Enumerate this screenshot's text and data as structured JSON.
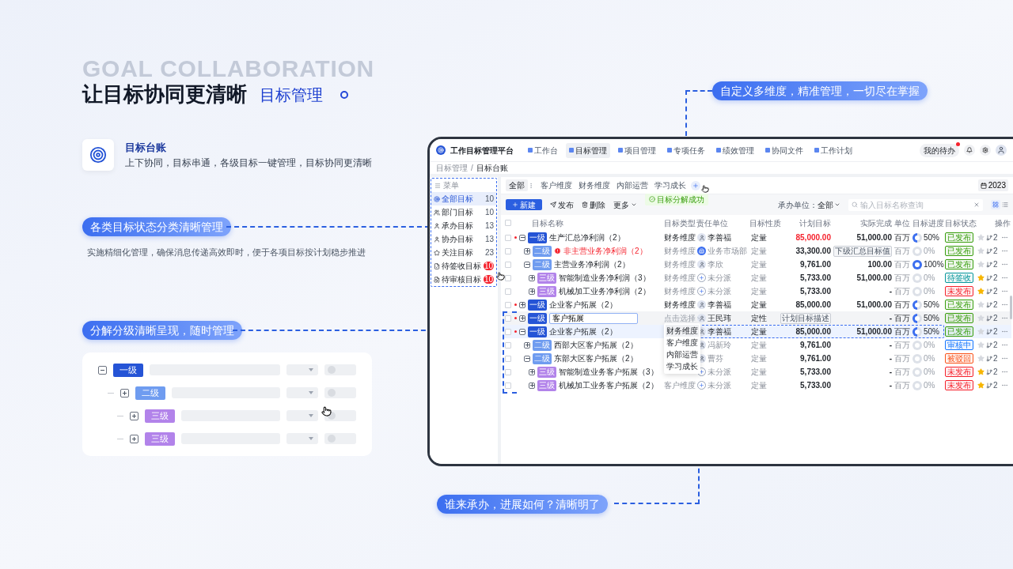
{
  "hero": {
    "ghost_title": "GOAL COLLABORATION",
    "title": "让目标协同更清晰",
    "subtitle": "目标管理"
  },
  "feature": {
    "title": "目标台账",
    "description": "上下协同，目标串通，各级目标一键管理，目标协同更清晰"
  },
  "callout_status": {
    "text": "各类目标状态分类清晰管理",
    "description": "实施精细化管理，确保消息传递高效即时，便于各项目标按计划稳步推进"
  },
  "callout_tree": {
    "text": "分解分级清晰呈现，随时管理"
  },
  "tree_demo": {
    "nodes": [
      {
        "tag": "一级",
        "expanded": true,
        "children": [
          {
            "tag": "二级",
            "expanded": false,
            "children": [
              {
                "tag": "三级",
                "expanded": false
              },
              {
                "tag": "三级",
                "expanded": false
              }
            ]
          }
        ]
      }
    ]
  },
  "callout_dimensions": {
    "text": "自定义多维度，精准管理，一切尽在掌握"
  },
  "callout_owner": {
    "text": "谁来承办，进展如何？清晰明了"
  },
  "app": {
    "brand": "工作目标管理平台",
    "nav": [
      {
        "label": "工作台",
        "selected": false
      },
      {
        "label": "目标管理",
        "selected": true
      },
      {
        "label": "项目管理",
        "selected": false
      },
      {
        "label": "专项任务",
        "selected": false
      },
      {
        "label": "绩效管理",
        "selected": false
      },
      {
        "label": "协同文件",
        "selected": false
      },
      {
        "label": "工作计划",
        "selected": false
      }
    ],
    "todo": {
      "label": "我的待办",
      "unread": true
    },
    "breadcrumb": {
      "items": [
        "目标管理",
        "目标台账"
      ],
      "separator": "/"
    },
    "sidebar": {
      "header": "菜单",
      "items": [
        {
          "label": "全部目标",
          "count": "10",
          "alert": false,
          "selected": true
        },
        {
          "label": "部门目标",
          "count": "10",
          "alert": false,
          "selected": false
        },
        {
          "label": "承办目标",
          "count": "13",
          "alert": false,
          "selected": false
        },
        {
          "label": "协办目标",
          "count": "13",
          "alert": false,
          "selected": false
        },
        {
          "label": "关注目标",
          "count": "23",
          "alert": false,
          "selected": false
        },
        {
          "label": "待签收目标",
          "count": "10",
          "alert": true,
          "selected": false
        },
        {
          "label": "待审核目标",
          "count": "10",
          "alert": true,
          "selected": false
        }
      ]
    },
    "tabs": [
      {
        "label": "全部",
        "selected": true
      },
      {
        "label": "客户维度",
        "selected": false
      },
      {
        "label": "财务维度",
        "selected": false
      },
      {
        "label": "内部运营",
        "selected": false
      },
      {
        "label": "学习成长",
        "selected": false
      }
    ],
    "year": "2023",
    "toast": "目标分解成功",
    "toolbar": {
      "new": "新建",
      "publish": "发布",
      "delete": "删除",
      "more": "更多"
    },
    "filter": {
      "label": "承办单位：",
      "value": "全部"
    },
    "search": {
      "placeholder": "输入目标名称查询"
    },
    "table": {
      "columns": [
        "目标名称",
        "目标类型",
        "责任单位",
        "目标性质",
        "计划目标",
        "实际完成",
        "单位",
        "目标进度",
        "目标状态",
        "操作"
      ],
      "select_all": {
        "checked": false
      },
      "rows": [
        {
          "kind": "goal",
          "checked": false,
          "tag": "一级",
          "name": "生产汇总净利润（2）",
          "expanded": true,
          "flagged": true,
          "alert": false,
          "highlighted": false,
          "type": "财务维度",
          "owner": {
            "name": "李善福",
            "kind": "person"
          },
          "nature": "定量",
          "plan": {
            "kind": "warning",
            "text": "85,000.00"
          },
          "actual": "51,000.00",
          "unit": "百万",
          "progress": {
            "level": 0.5,
            "text": "50%"
          },
          "status": {
            "text": "已发布",
            "color": "#389e0d"
          },
          "starred": false,
          "share": "2",
          "children": [
            {
              "kind": "goal",
              "checked": false,
              "tag": "二级",
              "name": "非主营业务净利润（2）",
              "expanded": false,
              "flagged": false,
              "alert": true,
              "highlighted": false,
              "type": "财务维度",
              "owner": {
                "name": "业务市场部",
                "kind": "org"
              },
              "nature": "定量",
              "plan": "33,300.00",
              "actual": {
                "kind": "tag",
                "text": "下级汇总目标值"
              },
              "unit": "百万",
              "progress": {
                "level": 0,
                "text": "0%"
              },
              "status": {
                "text": "已发布",
                "color": "#389e0d"
              },
              "starred": false,
              "share": "2"
            },
            {
              "kind": "goal",
              "checked": false,
              "tag": "二级",
              "name": "主营业务净利润（2）",
              "expanded": true,
              "flagged": false,
              "alert": false,
              "highlighted": false,
              "type": "财务维度",
              "owner": {
                "name": "李欣",
                "kind": "person"
              },
              "nature": "定量",
              "plan": "9,761.00",
              "actual": "100.00",
              "unit": "百万",
              "progress": {
                "level": 1,
                "text": "100%"
              },
              "status": {
                "text": "已发布",
                "color": "#389e0d"
              },
              "starred": false,
              "share": "2",
              "children": [
                {
                  "kind": "goal",
                  "checked": false,
                  "tag": "三级",
                  "name": "智能制造业务净利润（3）",
                  "expanded": false,
                  "flagged": false,
                  "alert": false,
                  "highlighted": false,
                  "type": "财务维度",
                  "owner": {
                    "name": "未分派",
                    "kind": "unassigned"
                  },
                  "nature": "定量",
                  "plan": "5,733.00",
                  "actual": "51,000.00",
                  "unit": "百万",
                  "progress": {
                    "level": 0,
                    "text": "0%"
                  },
                  "status": {
                    "text": "待签收",
                    "color": "#08979c"
                  },
                  "starred": true,
                  "share": "2"
                },
                {
                  "kind": "goal",
                  "checked": false,
                  "tag": "三级",
                  "name": "机械加工业务净利润（2）",
                  "expanded": false,
                  "flagged": false,
                  "alert": false,
                  "highlighted": false,
                  "type": "财务维度",
                  "owner": {
                    "name": "未分派",
                    "kind": "unassigned"
                  },
                  "nature": "定量",
                  "plan": "5,733.00",
                  "actual": "-",
                  "unit": "百万",
                  "progress": {
                    "level": 0,
                    "text": "0%"
                  },
                  "status": {
                    "text": "未发布",
                    "color": "#f5222d"
                  },
                  "starred": true,
                  "share": "2"
                }
              ]
            }
          ]
        },
        {
          "kind": "goal",
          "checked": false,
          "tag": "一级",
          "name": "企业客户拓展（2）",
          "expanded": false,
          "flagged": true,
          "alert": false,
          "highlighted": false,
          "type": "财务维度",
          "owner": {
            "name": "李善福",
            "kind": "person"
          },
          "nature": "定量",
          "plan": "85,000.00",
          "actual": "51,000.00",
          "unit": "百万",
          "progress": {
            "level": 0.5,
            "text": "50%"
          },
          "status": {
            "text": "已发布",
            "color": "#389e0d"
          },
          "starred": false,
          "share": "2"
        },
        {
          "kind": "edit",
          "checked": false,
          "tag": "一级",
          "name": "客户拓展",
          "expanded": false,
          "flagged": true,
          "alert": false,
          "highlighted": false,
          "type_placeholder": "点击选择",
          "type_options": [
            {
              "label": "财务维度",
              "selected": true
            },
            {
              "label": "客户维度",
              "selected": false
            },
            {
              "label": "内部运营",
              "selected": false
            },
            {
              "label": "学习成长",
              "selected": false
            }
          ],
          "owner": {
            "name": "王民玮",
            "kind": "person"
          },
          "nature": "定性",
          "plan": {
            "kind": "tag",
            "text": "计划目标描述"
          },
          "actual": "-",
          "unit": "百万",
          "progress": {
            "level": 0.5,
            "text": "50%"
          },
          "status": {
            "text": "已发布",
            "color": "#389e0d"
          },
          "starred": false,
          "share": "2"
        },
        {
          "kind": "goal",
          "checked": false,
          "tag": "一级",
          "name": "企业客户拓展（2）",
          "expanded": true,
          "flagged": true,
          "alert": false,
          "highlighted": true,
          "owner": {
            "name": "李善福",
            "kind": "person"
          },
          "nature": "定量",
          "plan": "85,000.00",
          "actual": "51,000.00",
          "unit": "百万",
          "progress": {
            "level": 0.5,
            "text": "50%"
          },
          "status": {
            "text": "已发布",
            "color": "#389e0d"
          },
          "starred": false,
          "share": "2",
          "children": [
            {
              "kind": "goal",
              "checked": false,
              "tag": "二级",
              "name": "西部大区客户拓展（2）",
              "expanded": false,
              "flagged": false,
              "alert": false,
              "highlighted": false,
              "owner": {
                "name": "冯新玲",
                "kind": "person"
              },
              "nature": "定量",
              "plan": "9,761.00",
              "actual": "-",
              "unit": "百万",
              "progress": {
                "level": 0,
                "text": "0%"
              },
              "status": {
                "text": "审核中",
                "color": "#1677ff"
              },
              "starred": false,
              "share": "2"
            },
            {
              "kind": "goal",
              "checked": false,
              "tag": "二级",
              "name": "东部大区客户拓展（2）",
              "expanded": true,
              "flagged": false,
              "alert": false,
              "highlighted": false,
              "owner": {
                "name": "曹芬",
                "kind": "person"
              },
              "nature": "定量",
              "plan": "9,761.00",
              "actual": "-",
              "unit": "百万",
              "progress": {
                "level": 0,
                "text": "0%"
              },
              "status": {
                "text": "被驳回",
                "color": "#fa541c"
              },
              "starred": false,
              "share": "2",
              "children": [
                {
                  "kind": "goal",
                  "checked": false,
                  "tag": "三级",
                  "name": "智能制造业务客户拓展（3）",
                  "expanded": false,
                  "flagged": false,
                  "alert": false,
                  "highlighted": false,
                  "owner": {
                    "name": "未分派",
                    "kind": "unassigned"
                  },
                  "nature": "定量",
                  "plan": "5,733.00",
                  "actual": "-",
                  "unit": "百万",
                  "progress": {
                    "level": 0,
                    "text": "0%"
                  },
                  "status": {
                    "text": "未发布",
                    "color": "#f5222d"
                  },
                  "starred": true,
                  "share": "2"
                },
                {
                  "kind": "goal",
                  "checked": false,
                  "tag": "三级",
                  "name": "机械加工业务客户拓展（2）",
                  "expanded": false,
                  "flagged": false,
                  "alert": false,
                  "highlighted": false,
                  "type": "客户维度",
                  "owner": {
                    "name": "未分派",
                    "kind": "unassigned"
                  },
                  "nature": "定量",
                  "plan": "5,733.00",
                  "actual": "-",
                  "unit": "百万",
                  "progress": {
                    "level": 0,
                    "text": "0%"
                  },
                  "status": {
                    "text": "未发布",
                    "color": "#f5222d"
                  },
                  "starred": true,
                  "share": "2"
                }
              ]
            }
          ]
        }
      ]
    }
  }
}
